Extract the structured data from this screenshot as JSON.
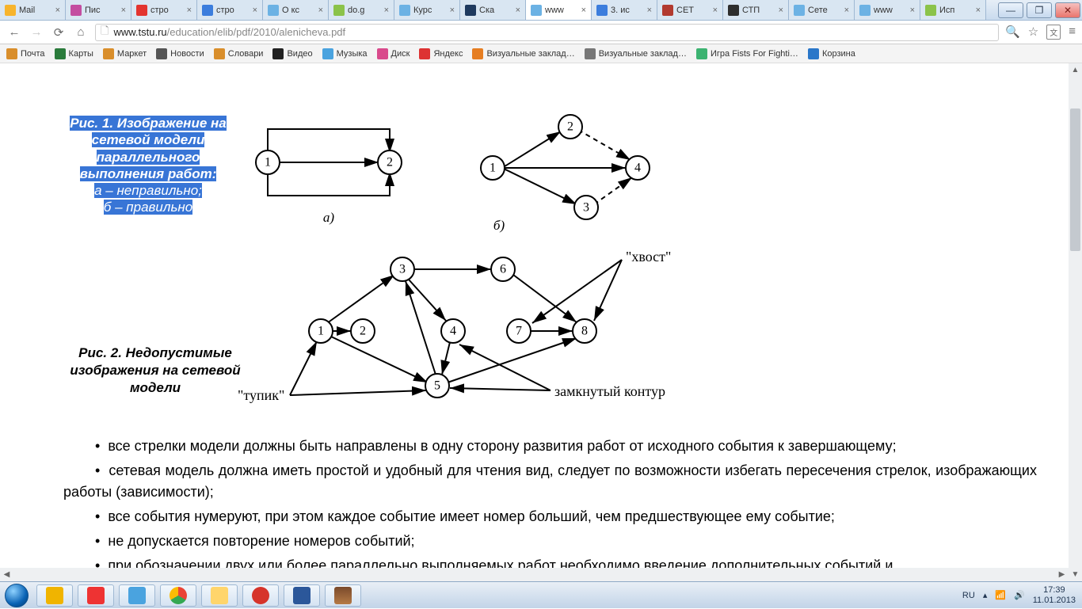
{
  "tabs": [
    {
      "label": "Mail",
      "color": "#f7b42c"
    },
    {
      "label": "Пис",
      "color": "#c44da0"
    },
    {
      "label": "стро",
      "color": "#e3342f"
    },
    {
      "label": "стро",
      "color": "#3b7ddd"
    },
    {
      "label": "О кс",
      "color": "#6cb2e4"
    },
    {
      "label": "do.g",
      "color": "#8bc34a"
    },
    {
      "label": "Курс",
      "color": "#6cb2e4"
    },
    {
      "label": "Ска",
      "color": "#1e3a5f"
    },
    {
      "label": "www",
      "color": "#6cb2e4",
      "active": true
    },
    {
      "label": "3. ис",
      "color": "#3b7ddd"
    },
    {
      "label": "СЕТ",
      "color": "#b23a2f"
    },
    {
      "label": "СТП",
      "color": "#2e2e2e"
    },
    {
      "label": "Сете",
      "color": "#6cb2e4"
    },
    {
      "label": "www",
      "color": "#6cb2e4"
    },
    {
      "label": "Исп",
      "color": "#8bc34a"
    }
  ],
  "close_glyph": "×",
  "window_controls": {
    "min": "—",
    "max": "❐",
    "close": "✕"
  },
  "url": {
    "host": "www.tstu.ru",
    "path": "/education/elib/pdf/2010/alenicheva.pdf"
  },
  "bookmarks": [
    {
      "label": "Почта",
      "color": "#d98e2b"
    },
    {
      "label": "Карты",
      "color": "#2a7b3b"
    },
    {
      "label": "Маркет",
      "color": "#d98e2b"
    },
    {
      "label": "Новости",
      "color": "#555"
    },
    {
      "label": "Словари",
      "color": "#d98e2b"
    },
    {
      "label": "Видео",
      "color": "#222"
    },
    {
      "label": "Музыка",
      "color": "#4aa3df"
    },
    {
      "label": "Диск",
      "color": "#d94a8c"
    },
    {
      "label": "Яндекс",
      "color": "#d33"
    },
    {
      "label": "Визуальные заклад…",
      "color": "#e67e22"
    },
    {
      "label": "Визуальные заклад…",
      "color": "#777"
    },
    {
      "label": "Игра Fists For Fighti…",
      "color": "#3cb371"
    },
    {
      "label": "Корзина",
      "color": "#2a77c9"
    }
  ],
  "fig1": {
    "title": "Рис. 1. Изображение на сетевой модели параллельного выполнения работ:",
    "a_label": "а –",
    "a_text": " неправильно;",
    "b_label": "б –",
    "b_text": " правильно",
    "under_a": "а)",
    "under_b": "б)"
  },
  "fig2": {
    "caption": "Рис. 2. Недопустимые изображения на сетевой модели",
    "label_tail": "\"хвост\"",
    "label_deadend": "\"тупик\"",
    "label_loop": "замкнутый контур"
  },
  "bullets": {
    "b1": "все стрелки модели должны быть направлены в одну сторону развития работ от исходного события к завершающему;",
    "b2": "сетевая модель должна иметь простой и удобный для чтения вид, следует по возможности избегать пересечения стрелок, изображающих работы (зависимости);",
    "b3": "все события нумеруют, при этом каждое событие имеет номер больший, чем предшествующее ему событие;",
    "b4": "не допускается повторение номеров событий;",
    "b5": "при обозначении двух или более параллельно выполняемых работ необходимо введение дополнительных событий и"
  },
  "tray": {
    "lang": "RU",
    "time": "17:39",
    "date": "11.01.2013"
  },
  "chart_data": [
    {
      "type": "diagram",
      "id": "fig1a",
      "nodes": [
        1,
        2
      ],
      "edges": [
        [
          1,
          2
        ],
        [
          1,
          2
        ],
        [
          1,
          2
        ]
      ],
      "label": "а)",
      "note": "неправильно"
    },
    {
      "type": "diagram",
      "id": "fig1b",
      "nodes": [
        1,
        2,
        3,
        4
      ],
      "edges": [
        [
          1,
          2
        ],
        [
          1,
          4
        ],
        [
          1,
          3
        ],
        [
          2,
          4
        ],
        [
          3,
          4
        ]
      ],
      "dashed": [
        [
          2,
          4
        ],
        [
          3,
          4
        ]
      ],
      "label": "б)",
      "note": "правильно"
    },
    {
      "type": "diagram",
      "id": "fig2",
      "nodes": [
        1,
        2,
        3,
        4,
        5,
        6,
        7,
        8
      ],
      "edges": [
        [
          1,
          2
        ],
        [
          1,
          3
        ],
        [
          1,
          5
        ],
        [
          5,
          3
        ],
        [
          3,
          4
        ],
        [
          4,
          5
        ],
        [
          3,
          6
        ],
        [
          6,
          8
        ],
        [
          7,
          8
        ],
        [
          5,
          8
        ]
      ],
      "annotations": {
        "тупик": [
          1,
          5
        ],
        "замкнутый контур": [
          3,
          4,
          5
        ],
        "хвост": [
          7,
          8
        ]
      }
    }
  ]
}
